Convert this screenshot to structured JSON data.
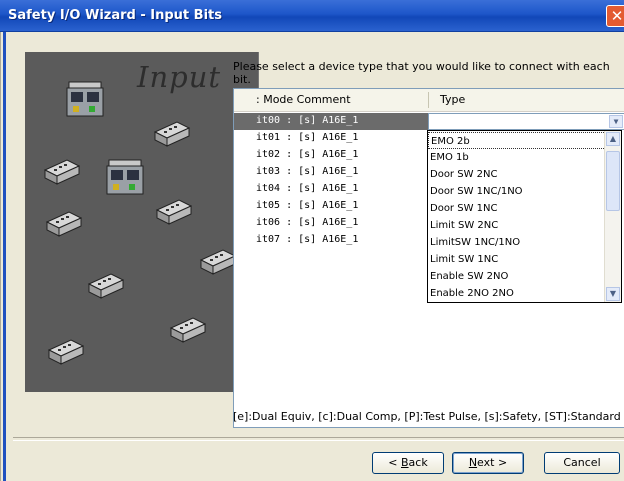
{
  "window": {
    "title": "Safety I/O Wizard - Input Bits",
    "close_glyph": "✕"
  },
  "image_panel": {
    "caption": "Input"
  },
  "prompt": "Please select a device type that you would like to connect with each bit.",
  "table": {
    "columns": [
      ": Mode Comment",
      "Type"
    ],
    "rows": [
      {
        "bit": "it00 : [s] A16E_1",
        "type": ""
      },
      {
        "bit": "it01 : [s] A16E_1"
      },
      {
        "bit": "it02 : [s] A16E_1"
      },
      {
        "bit": "it03 : [s] A16E_1"
      },
      {
        "bit": "it04 : [s] A16E_1"
      },
      {
        "bit": "it05 : [s] A16E_1"
      },
      {
        "bit": "it06 : [s] A16E_1"
      },
      {
        "bit": "it07 : [s] A16E_1"
      }
    ]
  },
  "dropdown": {
    "options": [
      "EMO 2b",
      "EMO 1b",
      "Door SW 2NC",
      "Door SW 1NC/1NO",
      "Door SW 1NC",
      "Limit SW 2NC",
      "LimitSW 1NC/1NO",
      "Limit SW 1NC",
      "Enable SW 2NO",
      "Enable 2NO 2NO"
    ],
    "focused": "EMO 2b"
  },
  "legend": "[e]:Dual Equiv, [c]:Dual Comp, [P]:Test Pulse, [s]:Safety, [ST]:Standard",
  "buttons": {
    "back": {
      "prefix": "< ",
      "key": "B",
      "rest": "ack"
    },
    "next": {
      "key": "N",
      "rest": "ext >"
    },
    "cancel": "Cancel"
  },
  "colors": {
    "title_bar": "#1d56c9",
    "panel_bg": "#5b5b5b",
    "selection": "#6b6b6b",
    "window_bg": "#ECE9D8"
  },
  "icons": {
    "scroll_up": "▲",
    "scroll_down": "▼",
    "combo_arrow": "▼"
  }
}
